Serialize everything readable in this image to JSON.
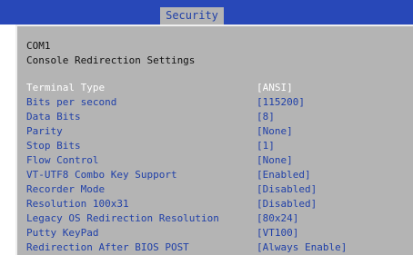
{
  "header": {
    "active_tab": "Security"
  },
  "section": {
    "line1": "COM1",
    "line2": "Console Redirection Settings"
  },
  "settings": [
    {
      "label": "Terminal Type",
      "value": "[ANSI]",
      "selected": true
    },
    {
      "label": "Bits per second",
      "value": "[115200]",
      "selected": false
    },
    {
      "label": "Data Bits",
      "value": "[8]",
      "selected": false
    },
    {
      "label": "Parity",
      "value": "[None]",
      "selected": false
    },
    {
      "label": "Stop Bits",
      "value": "[1]",
      "selected": false
    },
    {
      "label": "Flow Control",
      "value": "[None]",
      "selected": false
    },
    {
      "label": "VT-UTF8 Combo Key Support",
      "value": "[Enabled]",
      "selected": false
    },
    {
      "label": "Recorder Mode",
      "value": "[Disabled]",
      "selected": false
    },
    {
      "label": "Resolution 100x31",
      "value": "[Disabled]",
      "selected": false
    },
    {
      "label": "Legacy OS Redirection Resolution",
      "value": "[80x24]",
      "selected": false
    },
    {
      "label": "Putty KeyPad",
      "value": "[VT100]",
      "selected": false
    },
    {
      "label": "Redirection After BIOS POST",
      "value": "[Always Enable]",
      "selected": false
    }
  ],
  "colors": {
    "header_bg": "#2848b8",
    "panel_bg": "#b4b4b4",
    "item_text": "#2040a8",
    "selected_text": "#ffffff"
  }
}
